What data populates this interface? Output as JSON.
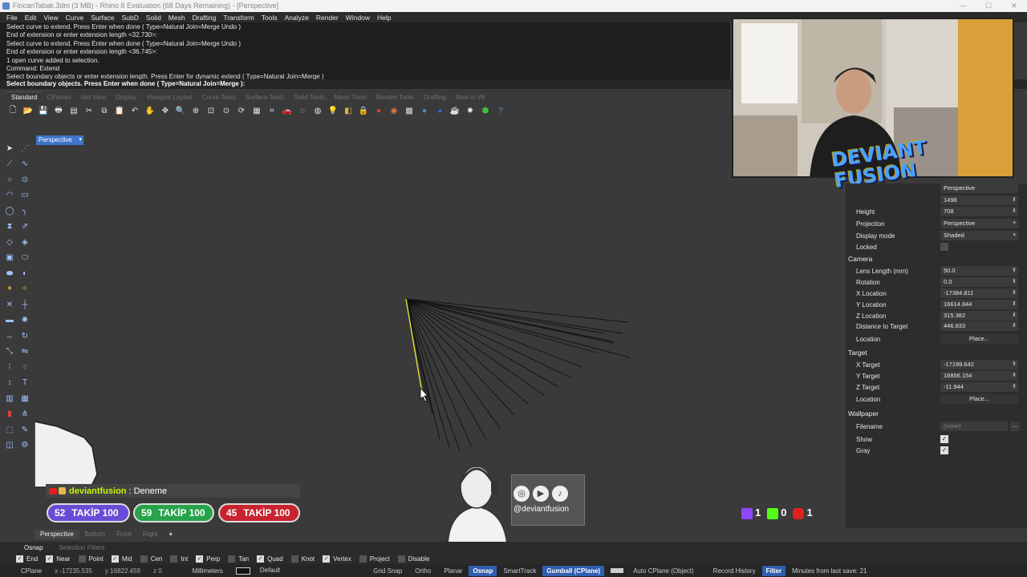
{
  "window": {
    "title": "FincanTabak.3dm (3 MB) - Rhino 8 Evaluation (68 Days Remaining) - [Perspective]"
  },
  "menu": [
    "File",
    "Edit",
    "View",
    "Curve",
    "Surface",
    "SubD",
    "Solid",
    "Mesh",
    "Drafting",
    "Transform",
    "Tools",
    "Analyze",
    "Render",
    "Window",
    "Help"
  ],
  "command_history": [
    "Select curve to extend. Press Enter when done ( Type=Natural  Join=Merge  Undo )",
    "End of extension or enter extension length <32.730>:",
    "Select curve to extend. Press Enter when done ( Type=Natural  Join=Merge  Undo )",
    "End of extension or enter extension length <36.745>:",
    "1 open curve added to selection.",
    "Command: Extend",
    "Select boundary objects or enter extension length. Press Enter for dynamic extend ( Type=Natural  Join=Merge )"
  ],
  "command_prompt": "Select boundary objects. Press Enter when done ( Type=Natural  Join=Merge ):",
  "toolbar_tabs": [
    "Standard",
    "CPlanes",
    "Set View",
    "Display",
    "Viewport Layout",
    "Curve Tools",
    "Surface Tools",
    "Solid Tools",
    "Mesh Tools",
    "Render Tools",
    "Drafting",
    "New in V8"
  ],
  "viewport": {
    "label": "Perspective"
  },
  "properties": {
    "title_value": "Perspective",
    "width_value": "1498",
    "height_label": "Height",
    "height_value": "708",
    "projection_label": "Projection",
    "projection_value": "Perspective",
    "display_label": "Display mode",
    "display_value": "Shaded",
    "locked_label": "Locked",
    "camera_section": "Camera",
    "lens_label": "Lens Length (mm)",
    "lens_value": "50.0",
    "rotation_label": "Rotation",
    "rotation_value": "0.0",
    "xloc_label": "X Location",
    "xloc_value": "-17384.811",
    "yloc_label": "Y Location",
    "yloc_value": "16614.844",
    "zloc_label": "Z Location",
    "zloc_value": "315.382",
    "dist_label": "Distance to Target",
    "dist_value": "446.833",
    "location_label": "Location",
    "place_label": "Place...",
    "target_section": "Target",
    "xtarget_label": "X Target",
    "xtarget_value": "-17199.642",
    "ytarget_label": "Y Target",
    "ytarget_value": "16856.154",
    "ztarget_label": "Z Target",
    "ztarget_value": "-11.944",
    "tlocation_label": "Location",
    "tplace_label": "Place...",
    "wallpaper_section": "Wallpaper",
    "filename_label": "Filename",
    "filename_value": "(none)",
    "show_label": "Show",
    "gray_label": "Gray"
  },
  "overlay": {
    "brand": "DEVIANT FUSION",
    "chat_user": "deviantfusion",
    "chat_sep": ":",
    "chat_msg": "Deneme",
    "goals": [
      {
        "num": "52",
        "label": "TAKİP 100",
        "color": "#6a4bd6"
      },
      {
        "num": "59",
        "label": "TAKİP 100",
        "color": "#27a34a"
      },
      {
        "num": "45",
        "label": "TAKİP 100",
        "color": "#c8242f"
      }
    ],
    "handle": "@deviantfusion",
    "counts": {
      "twitch": "1",
      "kick": "0",
      "youtube": "1"
    }
  },
  "bottom_tabs": [
    "Perspective",
    "Bottom",
    "Front",
    "Right",
    "+"
  ],
  "osnap_tabs": [
    "Osnap",
    "Selection Filters"
  ],
  "osnaps": [
    {
      "label": "End",
      "on": true
    },
    {
      "label": "Near",
      "on": true
    },
    {
      "label": "Point",
      "on": false
    },
    {
      "label": "Mid",
      "on": true
    },
    {
      "label": "Cen",
      "on": false
    },
    {
      "label": "Int",
      "on": false
    },
    {
      "label": "Perp",
      "on": true
    },
    {
      "label": "Tan",
      "on": false
    },
    {
      "label": "Quad",
      "on": true
    },
    {
      "label": "Knot",
      "on": false
    },
    {
      "label": "Vertex",
      "on": true
    },
    {
      "label": "Project",
      "on": false
    },
    {
      "label": "Disable",
      "on": false
    }
  ],
  "status": {
    "cplane": "CPlane",
    "x": "x -17235.535",
    "y": "y 16822.459",
    "z": "z 0",
    "units": "Millimeters",
    "layer": "Default",
    "grid_snap": "Grid Snap",
    "ortho": "Ortho",
    "planar": "Planar",
    "osnap": "Osnap",
    "smarttrack": "SmartTrack",
    "gumball": "Gumball (CPlane)",
    "auto_cplane": "Auto CPlane (Object)",
    "record_history": "Record History",
    "filter": "Filter",
    "last_save": "Minutes from last save: 21"
  },
  "colors": {
    "accent": "#3f74c9",
    "selected_curve": "#e5e03a",
    "curves": "#111111",
    "chat_user": "#c5f500"
  }
}
